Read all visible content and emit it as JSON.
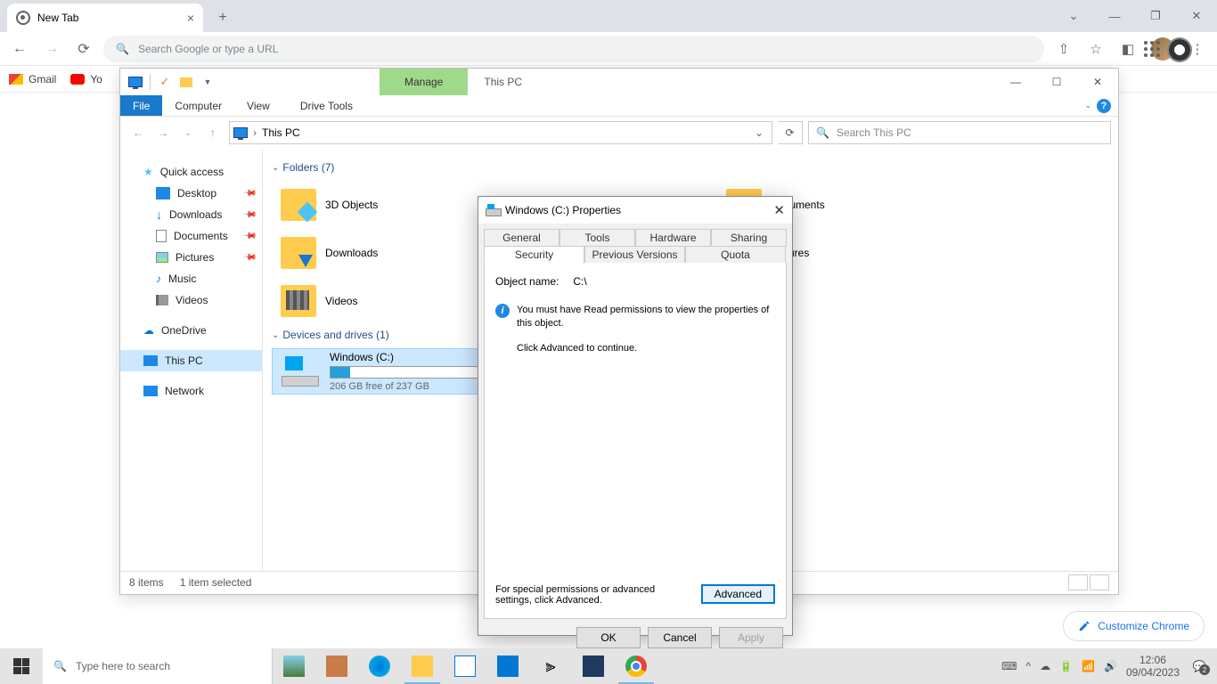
{
  "chrome": {
    "tab_title": "New Tab",
    "omnibox_placeholder": "Search Google or type a URL",
    "bookmarks": [
      "Gmail",
      "Yo"
    ],
    "customize": "Customize Chrome"
  },
  "explorer": {
    "title": "This PC",
    "manage_label": "Manage",
    "ribbon": {
      "file": "File",
      "home": "Computer",
      "share": "View",
      "view": "Drive Tools"
    },
    "breadcrumb": "This PC",
    "search_placeholder": "Search This PC",
    "sidebar": {
      "quick": "Quick access",
      "items": [
        "Desktop",
        "Downloads",
        "Documents",
        "Pictures",
        "Music",
        "Videos"
      ],
      "onedrive": "OneDrive",
      "thispc": "This PC",
      "network": "Network"
    },
    "folders_header": "Folders (7)",
    "folders": [
      "3D Objects",
      "Downloads",
      "Videos",
      "Documents",
      "Pictures"
    ],
    "drives_header": "Devices and drives (1)",
    "drive": {
      "name": "Windows (C:)",
      "free": "206 GB free of 237 GB"
    },
    "status": {
      "items": "8 items",
      "selected": "1 item selected"
    }
  },
  "props": {
    "title": "Windows (C:) Properties",
    "tabs_r1": [
      "General",
      "Tools",
      "Hardware",
      "Sharing"
    ],
    "tabs_r2": [
      "Security",
      "Previous Versions",
      "Quota"
    ],
    "object_label": "Object name:",
    "object_value": "C:\\",
    "perm_msg": "You must have Read permissions to view the properties of this object.",
    "continue_msg": "Click Advanced to continue.",
    "adv_msg": "For special permissions or advanced settings, click Advanced.",
    "advanced_btn": "Advanced",
    "ok": "OK",
    "cancel": "Cancel",
    "apply": "Apply"
  },
  "taskbar": {
    "search": "Type here to search",
    "time": "12:06",
    "date": "09/04/2023",
    "notif_count": "2"
  }
}
